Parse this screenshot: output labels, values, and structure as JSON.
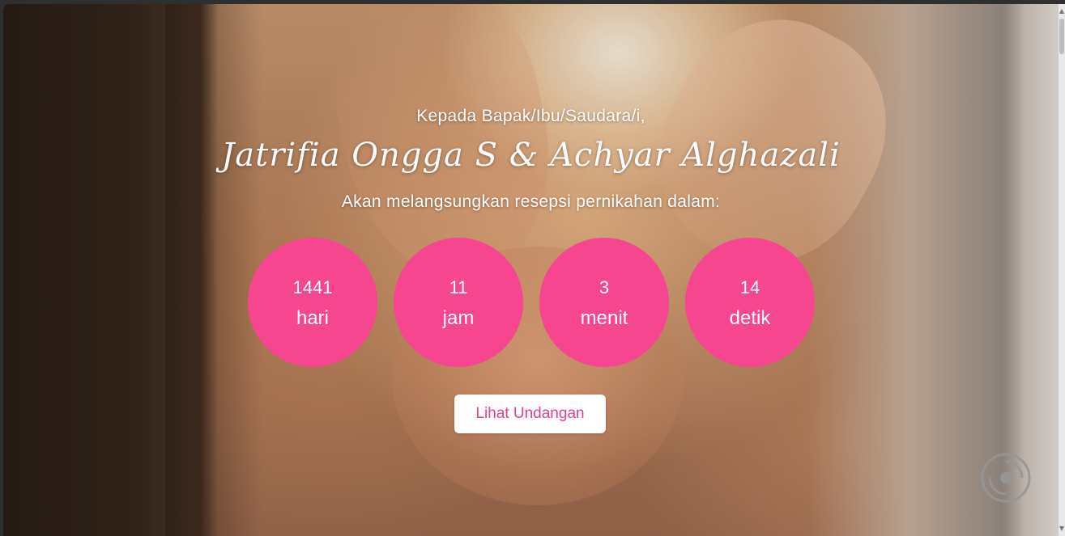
{
  "greeting": "Kepada Bapak/Ibu/Saudara/i,",
  "couple_names": "Jatrifia Ongga S & Achyar Alghazali",
  "subtitle": "Akan melangsungkan resepsi pernikahan dalam:",
  "countdown": [
    {
      "value": "1441",
      "unit": "hari"
    },
    {
      "value": "11",
      "unit": "jam"
    },
    {
      "value": "3",
      "unit": "menit"
    },
    {
      "value": "14",
      "unit": "detik"
    }
  ],
  "open_button_label": "Lihat Undangan",
  "icons": {
    "music": "music-disc-icon",
    "scroll_up": "triangle-up-icon",
    "scroll_down": "triangle-down-icon"
  },
  "colors": {
    "accent": "#f5468f",
    "button_text": "#e43f8b"
  }
}
